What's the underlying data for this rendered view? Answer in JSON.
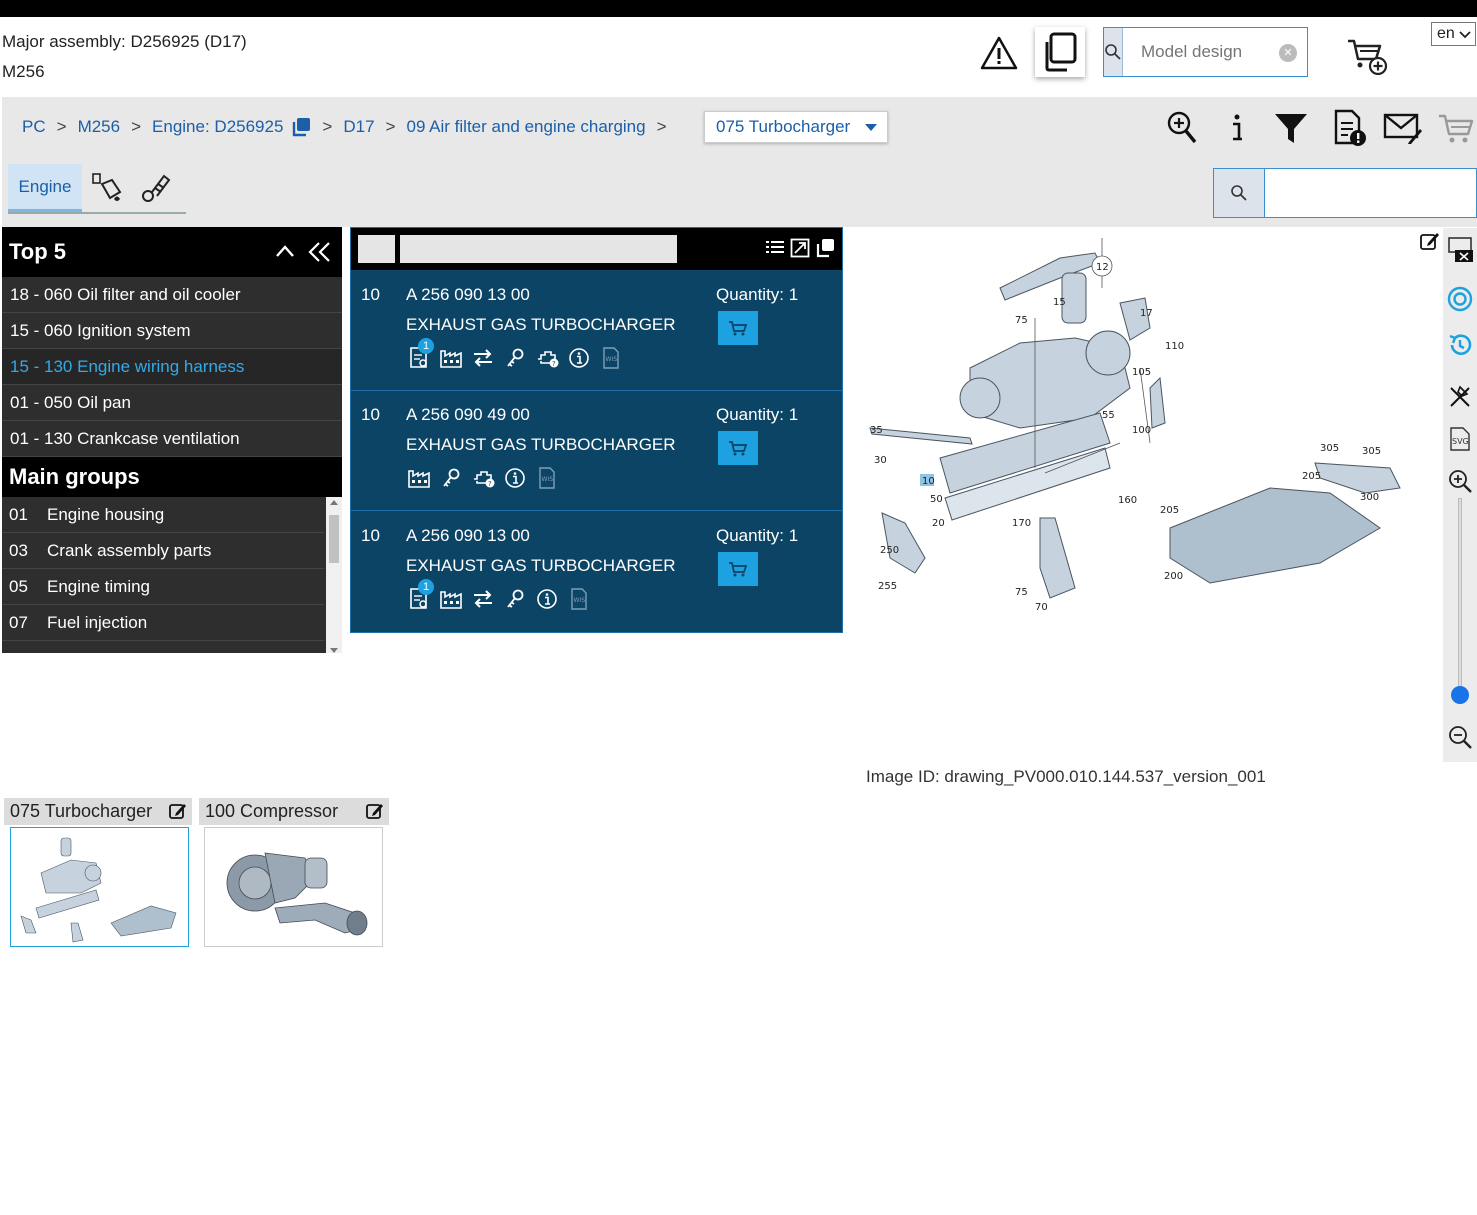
{
  "header": {
    "major_assembly": "Major assembly: D256925 (D17)",
    "model": "M256",
    "search_placeholder": "Model design",
    "language": "en"
  },
  "breadcrumb": {
    "items": [
      "PC",
      "M256",
      "Engine: D256925",
      "D17",
      "09 Air filter and engine charging"
    ],
    "current": "075 Turbocharger"
  },
  "tabs": {
    "engine": "Engine"
  },
  "top5": {
    "title": "Top 5",
    "items": [
      "18 - 060 Oil filter and oil cooler",
      "15 - 060 Ignition system",
      "15 - 130 Engine wiring harness",
      "01 - 050 Oil pan",
      "01 - 130 Crankcase ventilation"
    ]
  },
  "main_groups": {
    "title": "Main groups",
    "items": [
      {
        "num": "01",
        "label": "Engine housing"
      },
      {
        "num": "03",
        "label": "Crank assembly parts"
      },
      {
        "num": "05",
        "label": "Engine timing"
      },
      {
        "num": "07",
        "label": "Fuel injection"
      }
    ]
  },
  "parts": [
    {
      "pos": "10",
      "number": "A 256 090 13 00",
      "name": "EXHAUST GAS TURBOCHARGER",
      "quantity": "Quantity: 1",
      "badge": "1"
    },
    {
      "pos": "10",
      "number": "A 256 090 49 00",
      "name": "EXHAUST GAS TURBOCHARGER",
      "quantity": "Quantity: 1"
    },
    {
      "pos": "10",
      "number": "A 256 090 13 00",
      "name": "EXHAUST GAS TURBOCHARGER",
      "quantity": "Quantity: 1",
      "badge": "1"
    }
  ],
  "drawing": {
    "callouts": [
      "12",
      "15",
      "17",
      "75",
      "110",
      "105",
      "55",
      "100",
      "35",
      "30",
      "10",
      "50",
      "160",
      "20",
      "170",
      "250",
      "255",
      "75",
      "70",
      "305",
      "305",
      "205",
      "300",
      "205",
      "200"
    ],
    "image_id": "Image ID: drawing_PV000.010.144.537_version_001"
  },
  "thumbnails": [
    {
      "label": "075 Turbocharger"
    },
    {
      "label": "100 Compressor"
    }
  ],
  "colors": {
    "accent": "#1ea1e0",
    "parts_bg": "#0c4466",
    "link": "#1a5fa8",
    "active_item": "#33a9e8"
  }
}
